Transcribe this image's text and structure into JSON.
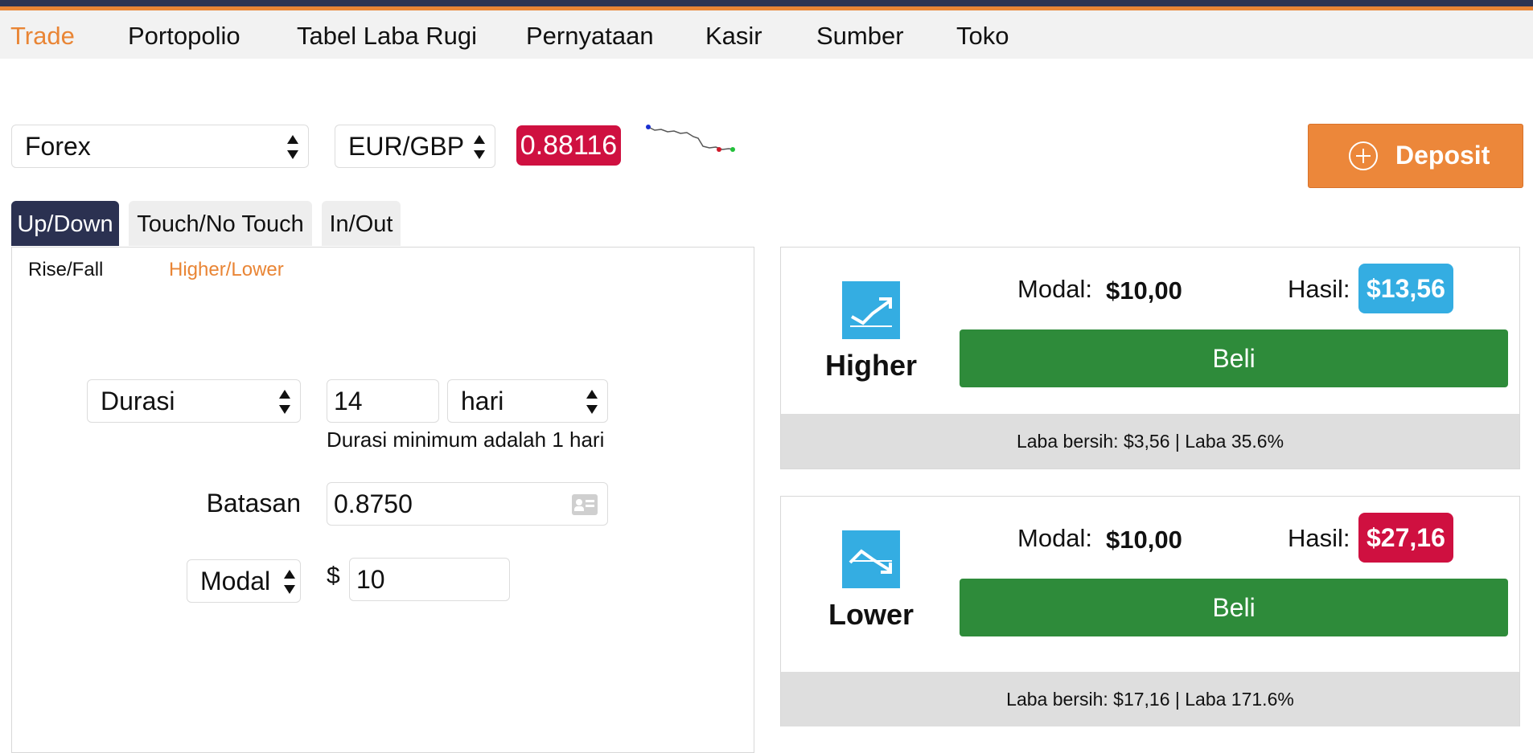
{
  "nav": {
    "items": [
      {
        "label": "Trade",
        "active": true
      },
      {
        "label": "Portopolio"
      },
      {
        "label": "Tabel Laba Rugi"
      },
      {
        "label": "Pernyataan"
      },
      {
        "label": "Kasir"
      },
      {
        "label": "Sumber"
      },
      {
        "label": "Toko"
      }
    ]
  },
  "market": {
    "category": "Forex",
    "symbol": "EUR/GBP",
    "price": "0.88116",
    "price_color": "#cf1040"
  },
  "deposit": {
    "label": "Deposit",
    "color": "#ec873a"
  },
  "tabs": [
    {
      "label": "Up/Down",
      "active": true
    },
    {
      "label": "Touch/No Touch"
    },
    {
      "label": "In/Out"
    }
  ],
  "subtabs": [
    {
      "label": "Rise/Fall"
    },
    {
      "label": "Higher/Lower",
      "active": true
    }
  ],
  "form": {
    "duration_type": "Durasi",
    "duration_value": "14",
    "duration_unit": "hari",
    "duration_hint": "Durasi minimum adalah 1 hari",
    "barrier_label": "Batasan",
    "barrier_value": "0.8750",
    "stake_type": "Modal",
    "currency_symbol": "$",
    "stake_value": "10"
  },
  "contracts": [
    {
      "direction": "Higher",
      "icon": "trend-up-icon",
      "modal_label": "Modal:",
      "modal_value": "$10,00",
      "hasil_label": "Hasil:",
      "hasil_value": "$13,56",
      "hasil_color": "#34ade2",
      "buy_label": "Beli",
      "footer": "Laba bersih: $3,56 | Laba 35.6%"
    },
    {
      "direction": "Lower",
      "icon": "trend-down-icon",
      "modal_label": "Modal:",
      "modal_value": "$10,00",
      "hasil_label": "Hasil:",
      "hasil_value": "$27,16",
      "hasil_color": "#cf1040",
      "buy_label": "Beli",
      "footer": "Laba bersih: $17,16 | Laba 171.6%"
    }
  ],
  "colors": {
    "accent": "#e98535",
    "nav_dark": "#2b3151",
    "buy_green": "#2e8b3a"
  }
}
